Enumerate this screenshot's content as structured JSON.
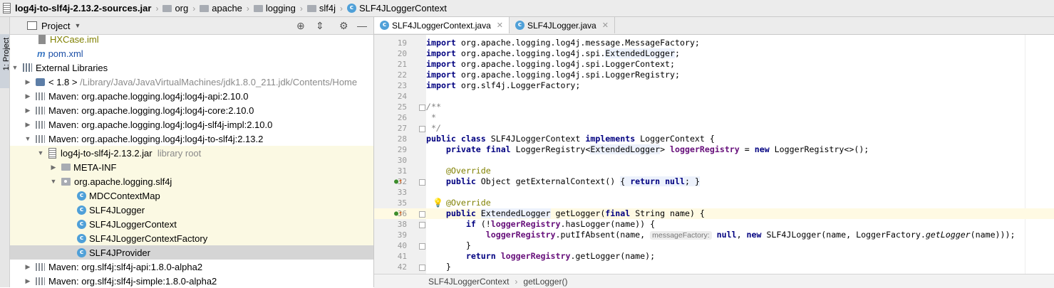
{
  "breadcrumb": {
    "jar": "log4j-to-slf4j-2.13.2-sources.jar",
    "items": [
      "org",
      "apache",
      "logging",
      "slf4j"
    ],
    "current": "SLF4JLoggerContext"
  },
  "tool_stripe": {
    "label": "1: Project"
  },
  "project_panel": {
    "title": "Project",
    "rows": [
      {
        "text": "HXCase.iml",
        "icon": "iml-file-icon"
      },
      {
        "text": "pom.xml",
        "icon": "maven-file-icon"
      },
      {
        "text": "External Libraries",
        "icon": "library-icon"
      },
      {
        "text": "< 1.8 >",
        "extra": "/Library/Java/JavaVirtualMachines/jdk1.8.0_211.jdk/Contents/Home",
        "icon": "jdk-icon"
      },
      {
        "text": "Maven: org.apache.logging.log4j:log4j-api:2.10.0",
        "icon": "maven-library-icon"
      },
      {
        "text": "Maven: org.apache.logging.log4j:log4j-core:2.10.0",
        "icon": "maven-library-icon"
      },
      {
        "text": "Maven: org.apache.logging.log4j:log4j-slf4j-impl:2.10.0",
        "icon": "maven-library-icon"
      },
      {
        "text": "Maven: org.apache.logging.log4j:log4j-to-slf4j:2.13.2",
        "icon": "maven-library-icon"
      },
      {
        "text": "log4j-to-slf4j-2.13.2.jar",
        "extra": "library root",
        "icon": "jar-icon"
      },
      {
        "text": "META-INF",
        "icon": "folder-icon"
      },
      {
        "text": "org.apache.logging.slf4j",
        "icon": "package-icon"
      },
      {
        "text": "MDCContextMap",
        "icon": "class-icon"
      },
      {
        "text": "SLF4JLogger",
        "icon": "class-icon"
      },
      {
        "text": "SLF4JLoggerContext",
        "icon": "class-icon"
      },
      {
        "text": "SLF4JLoggerContextFactory",
        "icon": "class-icon"
      },
      {
        "text": "SLF4JProvider",
        "icon": "class-icon"
      },
      {
        "text": "Maven: org.slf4j:slf4j-api:1.8.0-alpha2",
        "icon": "maven-library-icon"
      },
      {
        "text": "Maven: org.slf4j:slf4j-simple:1.8.0-alpha2",
        "icon": "maven-library-icon"
      }
    ]
  },
  "editor": {
    "tabs": [
      {
        "label": "SLF4JLoggerContext.java",
        "active": true
      },
      {
        "label": "SLF4JLogger.java",
        "active": false
      }
    ],
    "lines": {
      "l19": {
        "num": "19",
        "a": "import ",
        "b": "org.apache.logging.log4j.message.MessageFactory;"
      },
      "l20": {
        "num": "20",
        "a": "import ",
        "b": "org.apache.logging.log4j.spi.",
        "c": "ExtendedLogger",
        "d": ";"
      },
      "l21": {
        "num": "21",
        "a": "import ",
        "b": "org.apache.logging.log4j.spi.LoggerContext;"
      },
      "l22": {
        "num": "22",
        "a": "import ",
        "b": "org.apache.logging.log4j.spi.LoggerRegistry;"
      },
      "l23": {
        "num": "23",
        "a": "import ",
        "b": "org.slf4j.LoggerFactory;"
      },
      "l24": {
        "num": "24"
      },
      "l25": {
        "num": "25",
        "a": "/**"
      },
      "l26": {
        "num": "26",
        "a": " *"
      },
      "l27": {
        "num": "27",
        "a": " */"
      },
      "l28": {
        "num": "28",
        "a": "public class ",
        "b": "SLF4JLoggerContext ",
        "c": "implements ",
        "d": "LoggerContext {"
      },
      "l29": {
        "num": "29",
        "a": "    private final ",
        "b": "LoggerRegistry<",
        "c": "ExtendedLogger",
        "d": "> ",
        "e": "loggerRegistry",
        "f": " = ",
        "g": "new ",
        "h": "LoggerRegistry<>();"
      },
      "l30": {
        "num": "30"
      },
      "l31": {
        "num": "31",
        "a": "    @Override"
      },
      "l32": {
        "num": "32",
        "a": "    public ",
        "b": "Object getExternalContext() ",
        "c": "{ ",
        "d": "return null",
        "e": "; }"
      },
      "l33": {
        "num": "33"
      },
      "l34": {
        "num": "34"
      },
      "l35": {
        "num": "35",
        "a": "    @Override"
      },
      "l36": {
        "num": "36",
        "a": "    public ",
        "b": "ExtendedLogger",
        "c": " getLogger(",
        "d": "final ",
        "e": "String name) {"
      },
      "l37": {
        "num": "37"
      },
      "l38": {
        "num": "38",
        "a": "        if ",
        "b": "(!",
        "c": "loggerRegistry",
        "d": ".hasLogger(name)) {"
      },
      "l39": {
        "num": "39",
        "a": "            ",
        "b": "loggerRegistry",
        "c": ".putIfAbsent(name, ",
        "hint": "messageFactory:",
        "d": " null",
        "e": ", ",
        "f": "new ",
        "g": "SLF4JLogger(name, LoggerFactory.",
        "h": "getLogger",
        "i": "(name)));"
      },
      "l40": {
        "num": "40",
        "a": "        }"
      },
      "l41": {
        "num": "41",
        "a": "        return ",
        "b": "loggerRegistry",
        "c": ".getLogger(name);"
      },
      "l42": {
        "num": "42",
        "a": "    }"
      }
    },
    "status": {
      "class_name": "SLF4JLoggerContext",
      "method": "getLogger()"
    }
  },
  "colors": {
    "keyword": "#000080",
    "field": "#660e7a",
    "annotation": "#808000",
    "highlight_row": "#fbf9e3",
    "selected_row": "#d5d5d5",
    "class_icon": "#4fa0d8"
  }
}
